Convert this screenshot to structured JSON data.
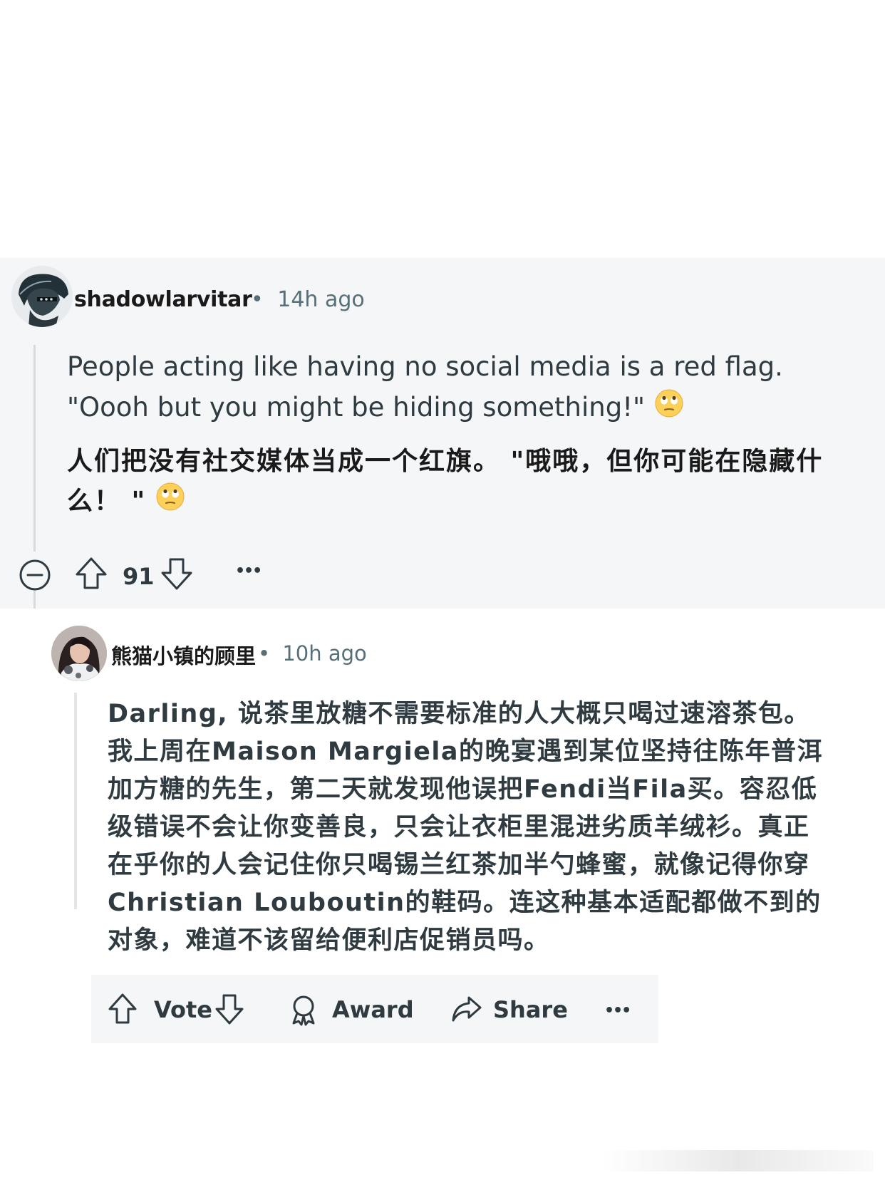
{
  "comment1": {
    "author": "shadowlarvitar",
    "separator": "•",
    "time": "14h ago",
    "text_en": "People acting like having no social media is a red flag. \"Oooh but you might be hiding something!\"",
    "text_zh": "人们把没有社交媒体当成一个红旗。 \"哦哦，但你可能在隐藏什么！ \"",
    "emoji": "eye-roll-emoji",
    "score": "91",
    "more": "•••"
  },
  "comment2": {
    "author": "熊猫小镇的顾里",
    "separator": "•",
    "time": "10h ago",
    "text": "Darling, 说茶里放糖不需要标准的人大概只喝过速溶茶包。我上周在Maison Margiela的晚宴遇到某位坚持往陈年普洱加方糖的先生，第二天就发现他误把Fendi当Fila买。容忍低级错误不会让你变善良，只会让衣柜里混进劣质羊绒衫。真正在乎你的人会记住你只喝锡兰红茶加半勺蜂蜜，就像记得你穿Christian Louboutin的鞋码。连这种基本适配都做不到的对象，难道不该留给便利店促销员吗。",
    "actions": {
      "vote": "Vote",
      "award": "Award",
      "share": "Share",
      "more": "•••"
    }
  },
  "icons": {
    "collapse": "collapse-icon",
    "upvote": "upvote-arrow-icon",
    "downvote": "downvote-arrow-icon",
    "award": "award-icon",
    "share": "share-icon"
  },
  "colors": {
    "panel_bg": "#f5f6f8",
    "meta_text": "#576f76",
    "thread_line": "#d4dadd"
  }
}
